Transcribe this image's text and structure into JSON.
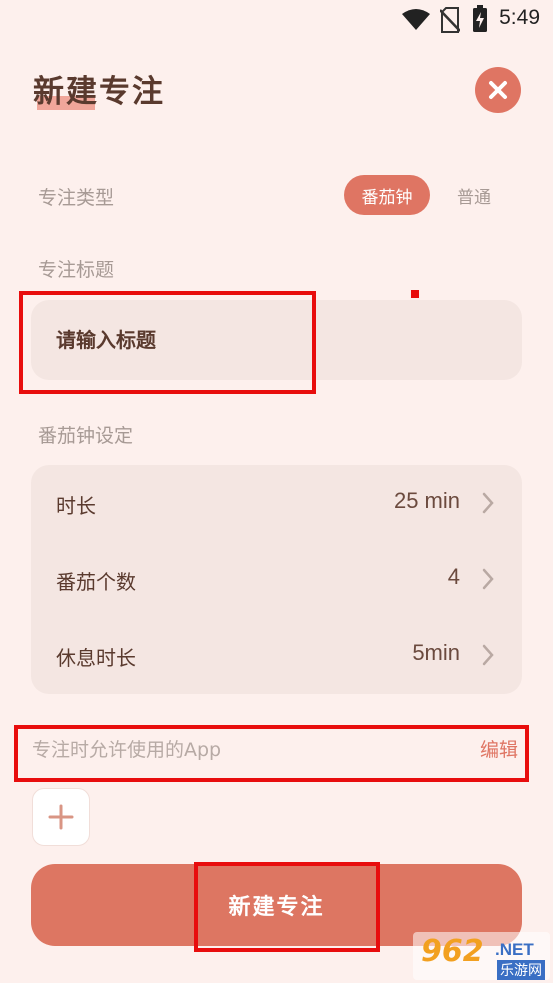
{
  "status_bar": {
    "time": "5:49",
    "icons": [
      "wifi-icon",
      "no-sim-icon",
      "battery-charging-icon"
    ]
  },
  "header": {
    "title": "新建专注",
    "close_icon": "close-icon"
  },
  "focus_type": {
    "label": "专注类型",
    "options": [
      "番茄钟",
      "普通"
    ],
    "selected": "番茄钟"
  },
  "focus_title": {
    "label": "专注标题",
    "placeholder": "请输入标题"
  },
  "pomodoro": {
    "label": "番茄钟设定",
    "rows": [
      {
        "label": "时长",
        "value": "25 min"
      },
      {
        "label": "番茄个数",
        "value": "4"
      },
      {
        "label": "休息时长",
        "value": "5min"
      }
    ]
  },
  "allowed_apps": {
    "label": "专注时允许使用的App",
    "edit_label": "编辑",
    "add_icon": "plus-icon"
  },
  "submit": {
    "label": "新建专注"
  },
  "watermark": {
    "number": "962",
    "domain": ".NET",
    "sub": "乐游网"
  },
  "colors": {
    "background": "#fdf0ed",
    "accent": "#df7563",
    "card": "#f4e6e2",
    "annotation": "#e80d0d"
  }
}
